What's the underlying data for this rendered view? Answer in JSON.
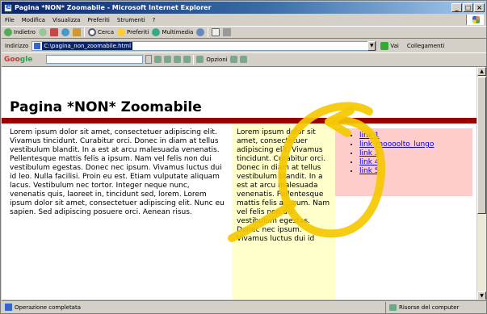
{
  "window": {
    "title": "Pagina *NON* Zoomabile - Microsoft Internet Explorer",
    "buttons": [
      "_",
      "□",
      "×"
    ]
  },
  "menu": {
    "items": [
      "File",
      "Modifica",
      "Visualizza",
      "Preferiti",
      "Strumenti",
      "?"
    ]
  },
  "toolbar": {
    "back_label": "Indietro",
    "search_label": "Cerca",
    "favorites_label": "Preferiti",
    "media_label": "Multimedia"
  },
  "address": {
    "label": "Indirizzo",
    "url": "C:\\pagina_non_zoomabile.html",
    "go_label": "Vai",
    "links_label": "Collegamenti"
  },
  "googlebar": {
    "logo_first": "Goo",
    "logo_rest": "gle",
    "settings_label": "Opzioni"
  },
  "page": {
    "title": "Pagina *NON* Zoomabile",
    "main_text": "Lorem ipsum dolor sit amet, consectetuer adipiscing elit. Vivamus tincidunt. Curabitur orci. Donec in diam at tellus vestibulum blandit. In a est at arcu malesuada venenatis. Pellentesque mattis felis a ipsum. Nam vel felis non dui vestibulum egestas. Donec nec ipsum. Vivamus luctus dui id leo. Nulla facilisi. Proin eu est. Etiam vulputate aliquam lacus. Vestibulum nec tortor. Integer neque nunc, venenatis quis, laoreet in, tincidunt sed, lorem. Lorem ipsum dolor sit amet, consectetuer adipiscing elit. Nunc eu sapien. Sed adipiscing posuere orci. Aenean risus.",
    "mid_text": "Lorem ipsum dolor sit amet, consectetuer adipiscing elit. Vivamus tincidunt. Curabitur orci. Donec in diam at tellus vestibulum blandit. In a est at arcu malesuada venenatis. Pellentesque mattis felis a ipsum. Nam vel felis non dui vestibulum egestas. Donec nec ipsum. Vivamus luctus dui id",
    "links": [
      "link 1",
      "link_moooolto_lungo",
      "link 3",
      "link 4",
      "link 5"
    ]
  },
  "status": {
    "left_text": "Operazione completata",
    "right_text": "Risorse del computer"
  },
  "colors": {
    "title_rule": "#990000",
    "mid_column_bg": "#ffffcc",
    "links_column_bg": "#ffcccc",
    "annotation": "#f5c800"
  }
}
